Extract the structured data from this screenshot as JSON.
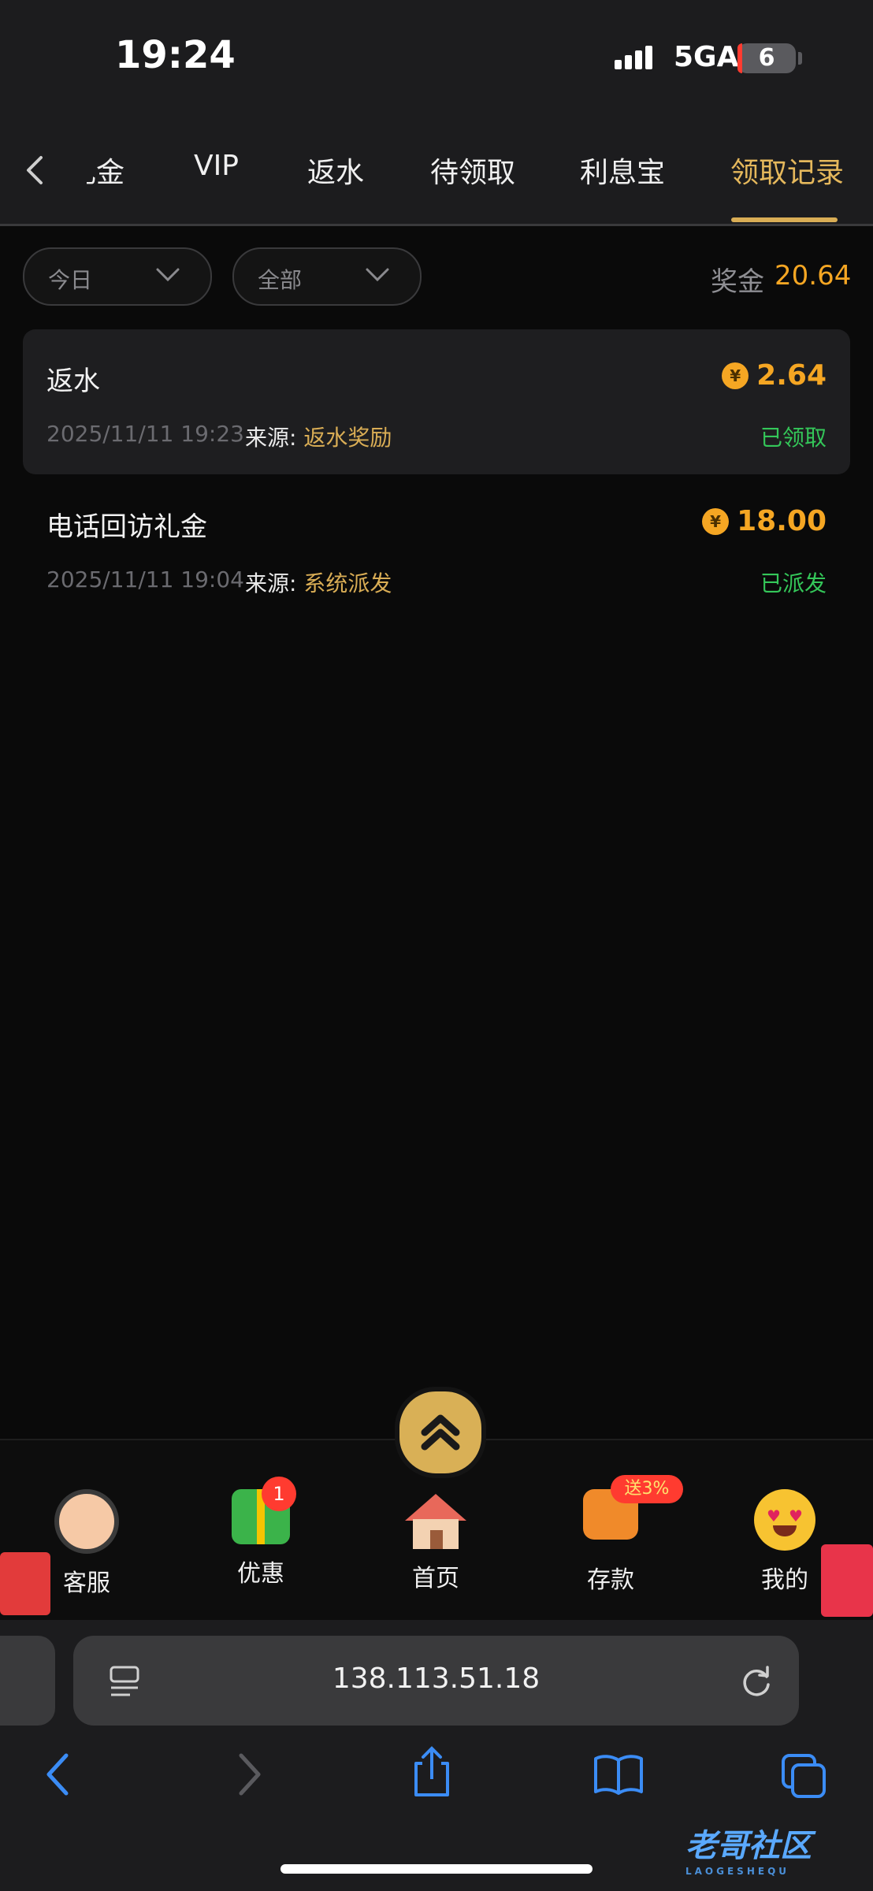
{
  "status": {
    "time": "19:24",
    "network": "5GA",
    "battery": "6"
  },
  "tabs": [
    {
      "label": "礼金",
      "active": false
    },
    {
      "label": "VIP",
      "active": false
    },
    {
      "label": "返水",
      "active": false
    },
    {
      "label": "待领取",
      "active": false
    },
    {
      "label": "利息宝",
      "active": false
    },
    {
      "label": "领取记录",
      "active": true
    }
  ],
  "filters": {
    "date": "今日",
    "type": "全部",
    "bonus_label": "奖金",
    "bonus_total": "20.64"
  },
  "records": [
    {
      "title": "返水",
      "amount": "2.64",
      "date": "2025/11/11 19:23",
      "source_label": "来源:",
      "source": "返水奖励",
      "status": "已领取"
    },
    {
      "title": "电话回访礼金",
      "amount": "18.00",
      "date": "2025/11/11 19:04",
      "source_label": "来源:",
      "source": "系统派发",
      "status": "已派发"
    }
  ],
  "coin_symbol": "¥",
  "bottom_nav": [
    {
      "label": "客服",
      "icon": "customer-service-icon"
    },
    {
      "label": "优惠",
      "icon": "gift-icon",
      "badge": "1"
    },
    {
      "label": "首页",
      "icon": "home-icon"
    },
    {
      "label": "存款",
      "icon": "wallet-icon",
      "badge": "送3%"
    },
    {
      "label": "我的",
      "icon": "profile-emoji-icon"
    }
  ],
  "browser": {
    "url": "138.113.51.18"
  },
  "watermark": {
    "text": "老哥社区",
    "sub": "LAOGESHEQU"
  },
  "colors": {
    "accent_gold": "#d9ad55",
    "amount_orange": "#f5a623",
    "status_green": "#34c759"
  }
}
